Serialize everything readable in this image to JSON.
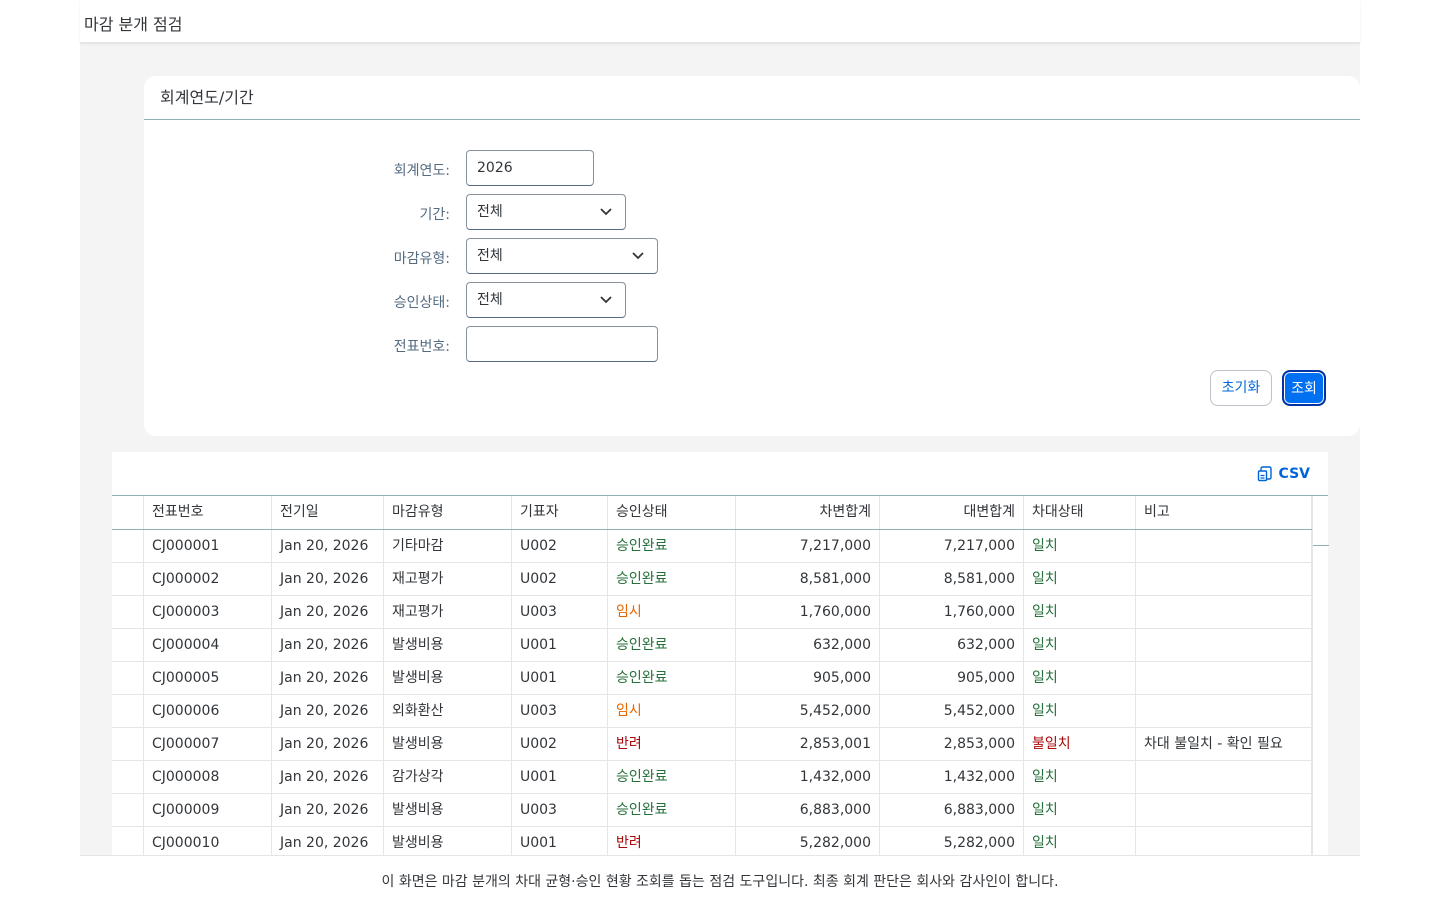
{
  "app": {
    "title": "마감 분개 점검"
  },
  "filter": {
    "panel_title": "회계연도/기간",
    "fiscal_year": {
      "label": "회계연도:",
      "value": "2026"
    },
    "period": {
      "label": "기간:",
      "value": "전체"
    },
    "closing_type": {
      "label": "마감유형:",
      "value": "전체"
    },
    "approval_status": {
      "label": "승인상태:",
      "value": "전체"
    },
    "document_no": {
      "label": "전표번호:",
      "value": ""
    },
    "reset_label": "초기화",
    "search_label": "조회"
  },
  "table": {
    "csv_label": "CSV",
    "columns": [
      "",
      "전표번호",
      "전기일",
      "마감유형",
      "기표자",
      "승인상태",
      "차변합계",
      "대변합계",
      "차대상태",
      "비고"
    ],
    "rows": [
      {
        "doc": "CJ000001",
        "date": "Jan 20, 2026",
        "type": "기타마감",
        "user": "U002",
        "approval": "승인완료",
        "approval_status": "ok",
        "debit": "7,217,000",
        "credit": "7,217,000",
        "balance": "일치",
        "balance_status": "ok",
        "note": ""
      },
      {
        "doc": "CJ000002",
        "date": "Jan 20, 2026",
        "type": "재고평가",
        "user": "U002",
        "approval": "승인완료",
        "approval_status": "ok",
        "debit": "8,581,000",
        "credit": "8,581,000",
        "balance": "일치",
        "balance_status": "ok",
        "note": ""
      },
      {
        "doc": "CJ000003",
        "date": "Jan 20, 2026",
        "type": "재고평가",
        "user": "U003",
        "approval": "임시",
        "approval_status": "warn",
        "debit": "1,760,000",
        "credit": "1,760,000",
        "balance": "일치",
        "balance_status": "ok",
        "note": ""
      },
      {
        "doc": "CJ000004",
        "date": "Jan 20, 2026",
        "type": "발생비용",
        "user": "U001",
        "approval": "승인완료",
        "approval_status": "ok",
        "debit": "632,000",
        "credit": "632,000",
        "balance": "일치",
        "balance_status": "ok",
        "note": ""
      },
      {
        "doc": "CJ000005",
        "date": "Jan 20, 2026",
        "type": "발생비용",
        "user": "U001",
        "approval": "승인완료",
        "approval_status": "ok",
        "debit": "905,000",
        "credit": "905,000",
        "balance": "일치",
        "balance_status": "ok",
        "note": ""
      },
      {
        "doc": "CJ000006",
        "date": "Jan 20, 2026",
        "type": "외화환산",
        "user": "U003",
        "approval": "임시",
        "approval_status": "warn",
        "debit": "5,452,000",
        "credit": "5,452,000",
        "balance": "일치",
        "balance_status": "ok",
        "note": ""
      },
      {
        "doc": "CJ000007",
        "date": "Jan 20, 2026",
        "type": "발생비용",
        "user": "U002",
        "approval": "반려",
        "approval_status": "bad",
        "debit": "2,853,001",
        "credit": "2,853,000",
        "balance": "불일치",
        "balance_status": "bad",
        "note": "차대 불일치 - 확인 필요"
      },
      {
        "doc": "CJ000008",
        "date": "Jan 20, 2026",
        "type": "감가상각",
        "user": "U001",
        "approval": "승인완료",
        "approval_status": "ok",
        "debit": "1,432,000",
        "credit": "1,432,000",
        "balance": "일치",
        "balance_status": "ok",
        "note": ""
      },
      {
        "doc": "CJ000009",
        "date": "Jan 20, 2026",
        "type": "발생비용",
        "user": "U003",
        "approval": "승인완료",
        "approval_status": "ok",
        "debit": "6,883,000",
        "credit": "6,883,000",
        "balance": "일치",
        "balance_status": "ok",
        "note": ""
      },
      {
        "doc": "CJ000010",
        "date": "Jan 20, 2026",
        "type": "발생비용",
        "user": "U001",
        "approval": "반려",
        "approval_status": "bad",
        "debit": "5,282,000",
        "credit": "5,282,000",
        "balance": "일치",
        "balance_status": "ok",
        "note": ""
      }
    ]
  },
  "footer": {
    "text": "이 화면은 마감 분개의 차대 균형·승인 현황 조회를 돕는 점검 도구입니다. 최종 회계 판단은 회사와 감사인이 합니다."
  },
  "colors": {
    "accent": "#0070f2",
    "ok": "#256f3a",
    "warn": "#e76500",
    "bad": "#aa0808"
  },
  "icons": {
    "dropdown": "chevron-down-icon",
    "export": "csv-export-icon"
  }
}
